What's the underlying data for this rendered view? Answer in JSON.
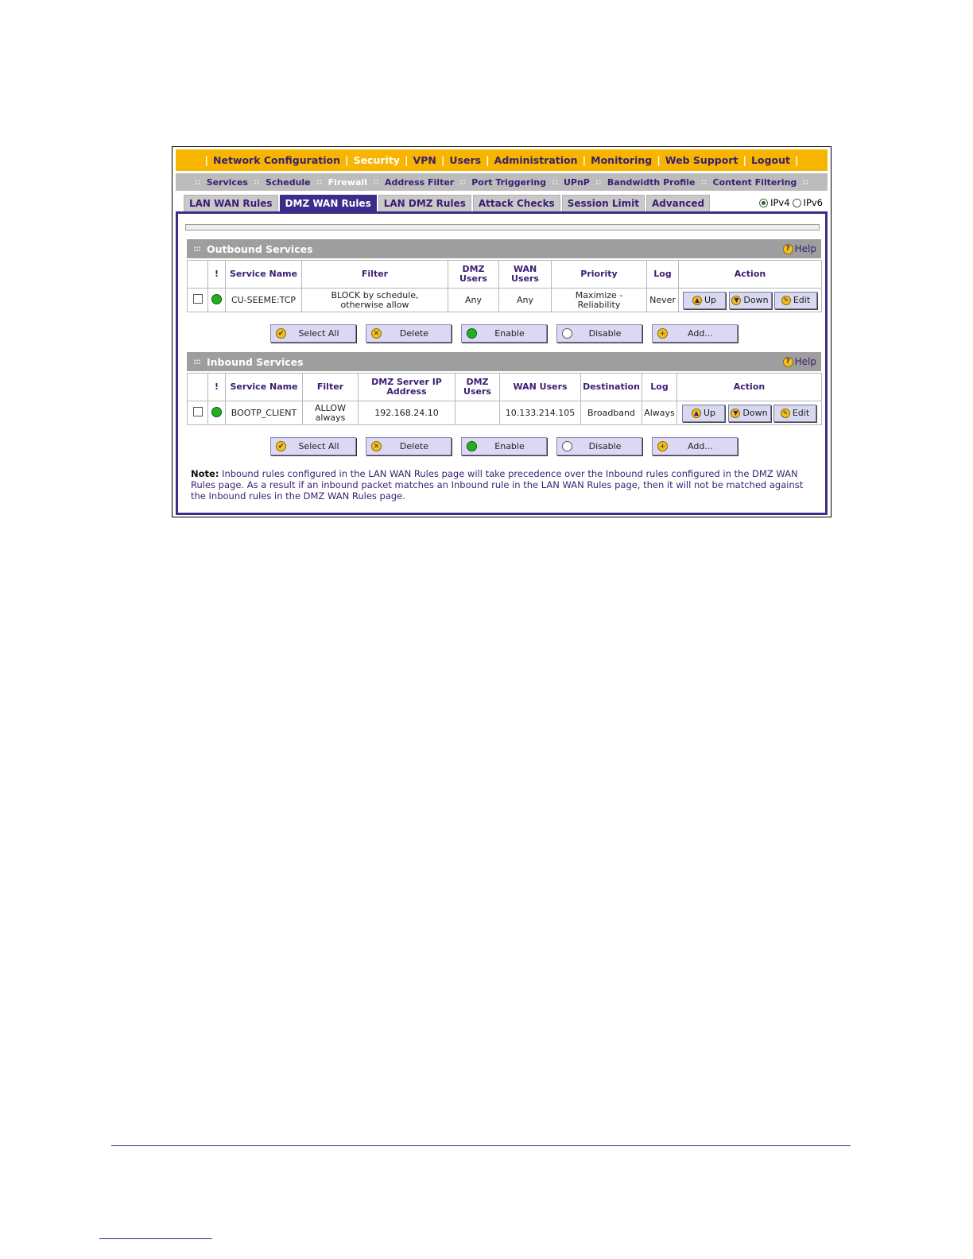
{
  "topnav": {
    "items": [
      {
        "label": "Network Configuration",
        "active": false
      },
      {
        "label": "Security",
        "active": true
      },
      {
        "label": "VPN",
        "active": false
      },
      {
        "label": "Users",
        "active": false
      },
      {
        "label": "Administration",
        "active": false
      },
      {
        "label": "Monitoring",
        "active": false
      },
      {
        "label": "Web Support",
        "active": false
      },
      {
        "label": "Logout",
        "active": false
      }
    ]
  },
  "subnav": {
    "items": [
      {
        "label": "Services",
        "active": false
      },
      {
        "label": "Schedule",
        "active": false
      },
      {
        "label": "Firewall",
        "active": true
      },
      {
        "label": "Address Filter",
        "active": false
      },
      {
        "label": "Port Triggering",
        "active": false
      },
      {
        "label": "UPnP",
        "active": false
      },
      {
        "label": "Bandwidth Profile",
        "active": false
      },
      {
        "label": "Content Filtering",
        "active": false
      }
    ]
  },
  "tabs": [
    {
      "label": "LAN WAN Rules",
      "active": false
    },
    {
      "label": "DMZ WAN Rules",
      "active": true
    },
    {
      "label": "LAN DMZ Rules",
      "active": false
    },
    {
      "label": "Attack Checks",
      "active": false
    },
    {
      "label": "Session Limit",
      "active": false
    },
    {
      "label": "Advanced",
      "active": false
    }
  ],
  "ip": {
    "ipv4": "IPv4",
    "ipv6": "IPv6",
    "selected": "IPv4"
  },
  "outbound": {
    "title": "Outbound Services",
    "help": "Help",
    "headers": [
      "!",
      "Service Name",
      "Filter",
      "DMZ Users",
      "WAN Users",
      "Priority",
      "Log",
      "Action"
    ],
    "rows": [
      {
        "service": "CU-SEEME:TCP",
        "filter_line1": "BLOCK by schedule,",
        "filter_line2": "otherwise allow",
        "dmz_users": "Any",
        "wan_users": "Any",
        "priority_line1": "Maximize -",
        "priority_line2": "Reliability",
        "log": "Never"
      }
    ]
  },
  "inbound": {
    "title": "Inbound Services",
    "help": "Help",
    "headers": [
      "!",
      "Service Name",
      "Filter",
      "DMZ Server IP Address",
      "DMZ Users",
      "WAN Users",
      "Destination",
      "Log",
      "Action"
    ],
    "rows": [
      {
        "service": "BOOTP_CLIENT",
        "filter_line1": "ALLOW",
        "filter_line2": "always",
        "dmz_server_ip": "192.168.24.10",
        "dmz_users": "",
        "wan_users": "10.133.214.105",
        "destination": "Broadband",
        "log": "Always"
      }
    ]
  },
  "row_actions": {
    "up": "Up",
    "down": "Down",
    "edit": "Edit"
  },
  "buttons": {
    "select_all": "Select All",
    "delete": "Delete",
    "enable": "Enable",
    "disable": "Disable",
    "add": "Add..."
  },
  "note": {
    "label": "Note:",
    "text": " Inbound rules configured in the LAN WAN Rules page will take precedence over the Inbound rules configured in the DMZ WAN Rules page. As a result if an inbound packet matches an Inbound rule in the LAN WAN Rules page, then it will not be matched against the Inbound rules in the DMZ WAN Rules page."
  },
  "colors": {
    "brand_orange": "#f7b500",
    "brand_purple": "#3d2c8a",
    "header_grey": "#9e9e9e",
    "status_green": "#22b020"
  }
}
